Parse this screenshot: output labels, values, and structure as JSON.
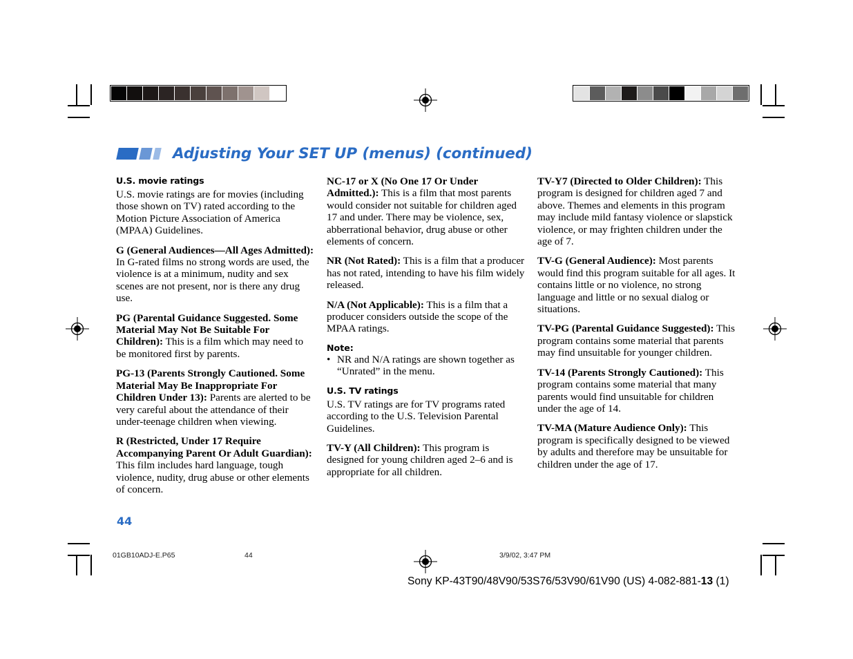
{
  "header": {
    "title": "Adjusting Your SET UP (menus) (continued)",
    "title_color": "#2a6cc4",
    "block_colors": [
      "#2a6cc4",
      "#6a97d6",
      "#9cbbe6"
    ]
  },
  "calibration": {
    "left_bar_swatches": [
      "#050505",
      "#120f0e",
      "#1d1817",
      "#2b2423",
      "#3a312f",
      "#4a403d",
      "#5f5350",
      "#7d716d",
      "#a0938f",
      "#d0c6c2",
      "#ffffff"
    ],
    "right_bar_swatches": [
      "#e3e3e3",
      "#5c5c5c",
      "#b2b2b2",
      "#1e1b1a",
      "#8c8c8c",
      "#4a4a4a",
      "#000000",
      "#f2f2f2",
      "#a8a8a8",
      "#d4d4d4",
      "#6e6e6e"
    ]
  },
  "columns": {
    "col1": {
      "section_heading": "U.S. movie ratings",
      "intro": "U.S. movie ratings are for movies (including those shown on TV) rated according to the Motion Picture Association of America (MPAA) Guidelines.",
      "entries": [
        {
          "term": "G (General Audiences—All Ages Admitted):",
          "definition": " In G-rated films no strong words are used, the violence is at a minimum, nudity and sex scenes are not present, nor is there any drug use."
        },
        {
          "term": "PG (Parental Guidance Suggested. Some Material May Not Be Suitable For Children):",
          "definition": " This is a film which may need to be monitored first by parents."
        },
        {
          "term": "PG-13 (Parents Strongly Cautioned. Some Material May Be Inappropriate For Children Under 13):",
          "definition": " Parents are alerted to be very careful about the attendance of their under-teenage children when viewing."
        },
        {
          "term": "R (Restricted, Under 17 Require Accompanying Parent Or Adult Guardian):",
          "definition": " This film includes hard language, tough violence, nudity, drug abuse or other elements of concern."
        }
      ]
    },
    "col2": {
      "entries_top": [
        {
          "term": "NC-17 or X (No One 17 Or Under Admitted.):",
          "definition": " This is a film that most parents would consider not suitable for children aged 17 and under. There may be violence, sex, abberrational behavior, drug abuse or other elements of concern."
        },
        {
          "term": "NR (Not Rated):",
          "definition": " This is a film that a producer has not rated, intending to have his film widely released."
        },
        {
          "term": "N/A (Not Applicable):",
          "definition": " This is a film that a producer considers outside the scope of the MPAA ratings."
        }
      ],
      "note_heading": "Note:",
      "note_bullet_marker": "•",
      "note_bullet": "NR and N/A ratings are shown together as “Unrated” in the menu.",
      "section_heading": "U.S. TV ratings",
      "intro": "U.S. TV ratings are for TV programs rated according to the U.S. Television Parental Guidelines.",
      "entries_bottom": [
        {
          "term": "TV-Y (All Children):",
          "definition": "  This program is designed for young children aged 2–6 and is appropriate for all children."
        }
      ]
    },
    "col3": {
      "entries": [
        {
          "term": "TV-Y7 (Directed to Older Children):",
          "definition": "  This program is designed for children aged 7 and above. Themes and elements in this program may include mild fantasy violence or slapstick violence, or may frighten children under the age of 7."
        },
        {
          "term": "TV-G (General Audience):",
          "definition": "  Most parents would find this program suitable for all ages. It contains little or no violence, no strong language and little or no sexual dialog or situations."
        },
        {
          "term": "TV-PG (Parental Guidance Suggested):",
          "definition": " This program contains some material that parents may find unsuitable for younger children."
        },
        {
          "term": "TV-14 (Parents Strongly Cautioned):",
          "definition": "  This program contains some material that many parents would find unsuitable for children under the age of 14."
        },
        {
          "term": "TV-MA (Mature Audience Only):",
          "definition": "  This program is specifically designed to be viewed by adults and therefore may be unsuitable for children under the age of 17."
        }
      ]
    }
  },
  "page_number": "44",
  "footer": {
    "file_name": "01GB10ADJ-E.P65",
    "page_marker": "44",
    "timestamp": "3/9/02, 3:47 PM",
    "model_prefix": "Sony KP-43T90/48V90/53S76/53V90/61V90 (US) 4-082-881-",
    "model_bold": "13",
    "model_suffix": " (1)"
  }
}
